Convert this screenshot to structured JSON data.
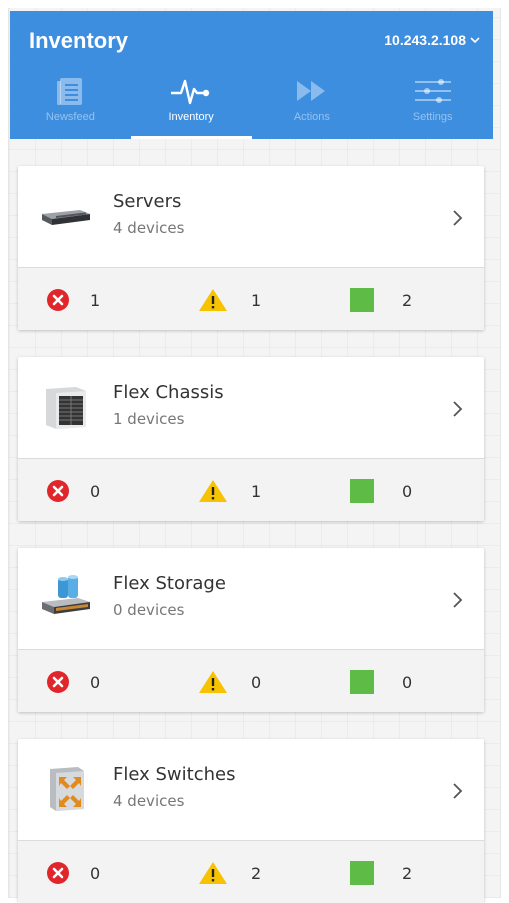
{
  "header": {
    "title": "Inventory",
    "host": "10.243.2.108"
  },
  "tabs": [
    {
      "label": "Newsfeed",
      "icon": "newsfeed-icon",
      "active": false
    },
    {
      "label": "Inventory",
      "icon": "pulse-icon",
      "active": true
    },
    {
      "label": "Actions",
      "icon": "fast-forward-icon",
      "active": false
    },
    {
      "label": "Settings",
      "icon": "sliders-icon",
      "active": false
    }
  ],
  "cards": [
    {
      "title": "Servers",
      "subtitle": "4 devices",
      "icon": "server-icon",
      "errors": "1",
      "warnings": "1",
      "ok": "2"
    },
    {
      "title": "Flex Chassis",
      "subtitle": "1 devices",
      "icon": "chassis-icon",
      "errors": "0",
      "warnings": "1",
      "ok": "0"
    },
    {
      "title": "Flex Storage",
      "subtitle": "0 devices",
      "icon": "storage-icon",
      "errors": "0",
      "warnings": "0",
      "ok": "0"
    },
    {
      "title": "Flex Switches",
      "subtitle": "4 devices",
      "icon": "switch-icon",
      "errors": "0",
      "warnings": "2",
      "ok": "2"
    }
  ],
  "colors": {
    "header": "#3e8ee0",
    "error": "#e0262b",
    "warning": "#f7c300",
    "ok": "#5dbb46"
  }
}
